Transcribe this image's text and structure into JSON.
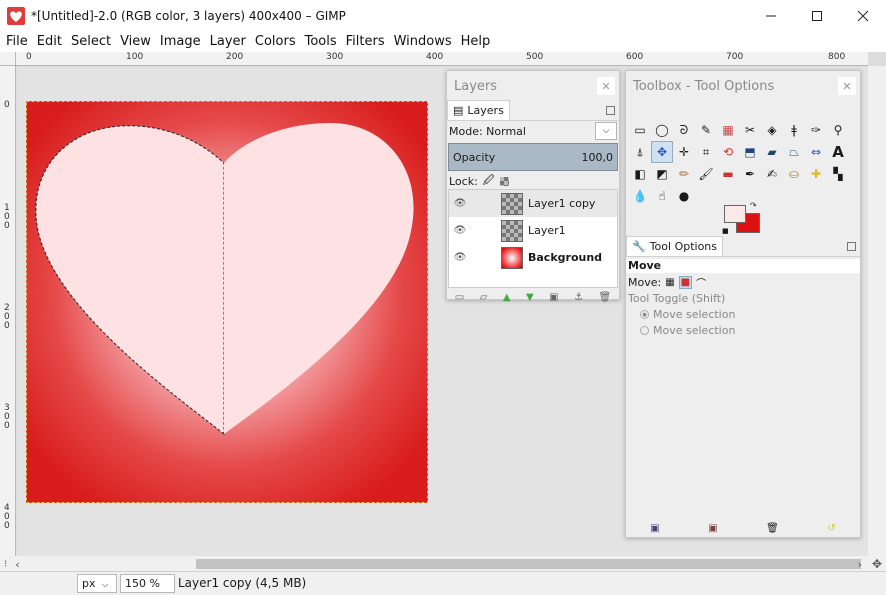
{
  "window": {
    "title": "*[Untitled]-2.0 (RGB color, 3 layers) 400x400 – GIMP"
  },
  "menu": [
    "File",
    "Edit",
    "Select",
    "View",
    "Image",
    "Layer",
    "Colors",
    "Tools",
    "Filters",
    "Windows",
    "Help"
  ],
  "ruler": {
    "h_labels": [
      "0",
      "100",
      "200",
      "300",
      "400",
      "500",
      "600",
      "700",
      "800"
    ],
    "v_labels": [
      "0",
      "1\n0\n0",
      "2\n0\n0",
      "3\n0\n0",
      "4\n0\n0"
    ]
  },
  "layers_dock": {
    "title": "Layers",
    "tab_label": "Layers",
    "mode_label": "Mode: Normal",
    "opacity_label": "Opacity",
    "opacity_value": "100,0",
    "lock_label": "Lock:",
    "layers": [
      {
        "name": "Layer1 copy",
        "bold": false
      },
      {
        "name": "Layer1",
        "bold": false
      },
      {
        "name": "Background",
        "bold": true
      }
    ]
  },
  "toolbox_dock": {
    "title": "Toolbox - Tool Options",
    "tool_options_tab": "Tool Options",
    "tool_name": "Move",
    "move_label": "Move:",
    "toggle_label": "Tool Toggle  (Shift)",
    "radio_1": "Move selection",
    "radio_2": "Move selection"
  },
  "status": {
    "unit": "px",
    "zoom": "150 %",
    "message": "Layer1 copy (4,5 MB)"
  },
  "colors": {
    "fg": "#fde8e8",
    "bg": "#dd1111",
    "heart": "#fde1e3",
    "image_red": "#d81b1b"
  }
}
